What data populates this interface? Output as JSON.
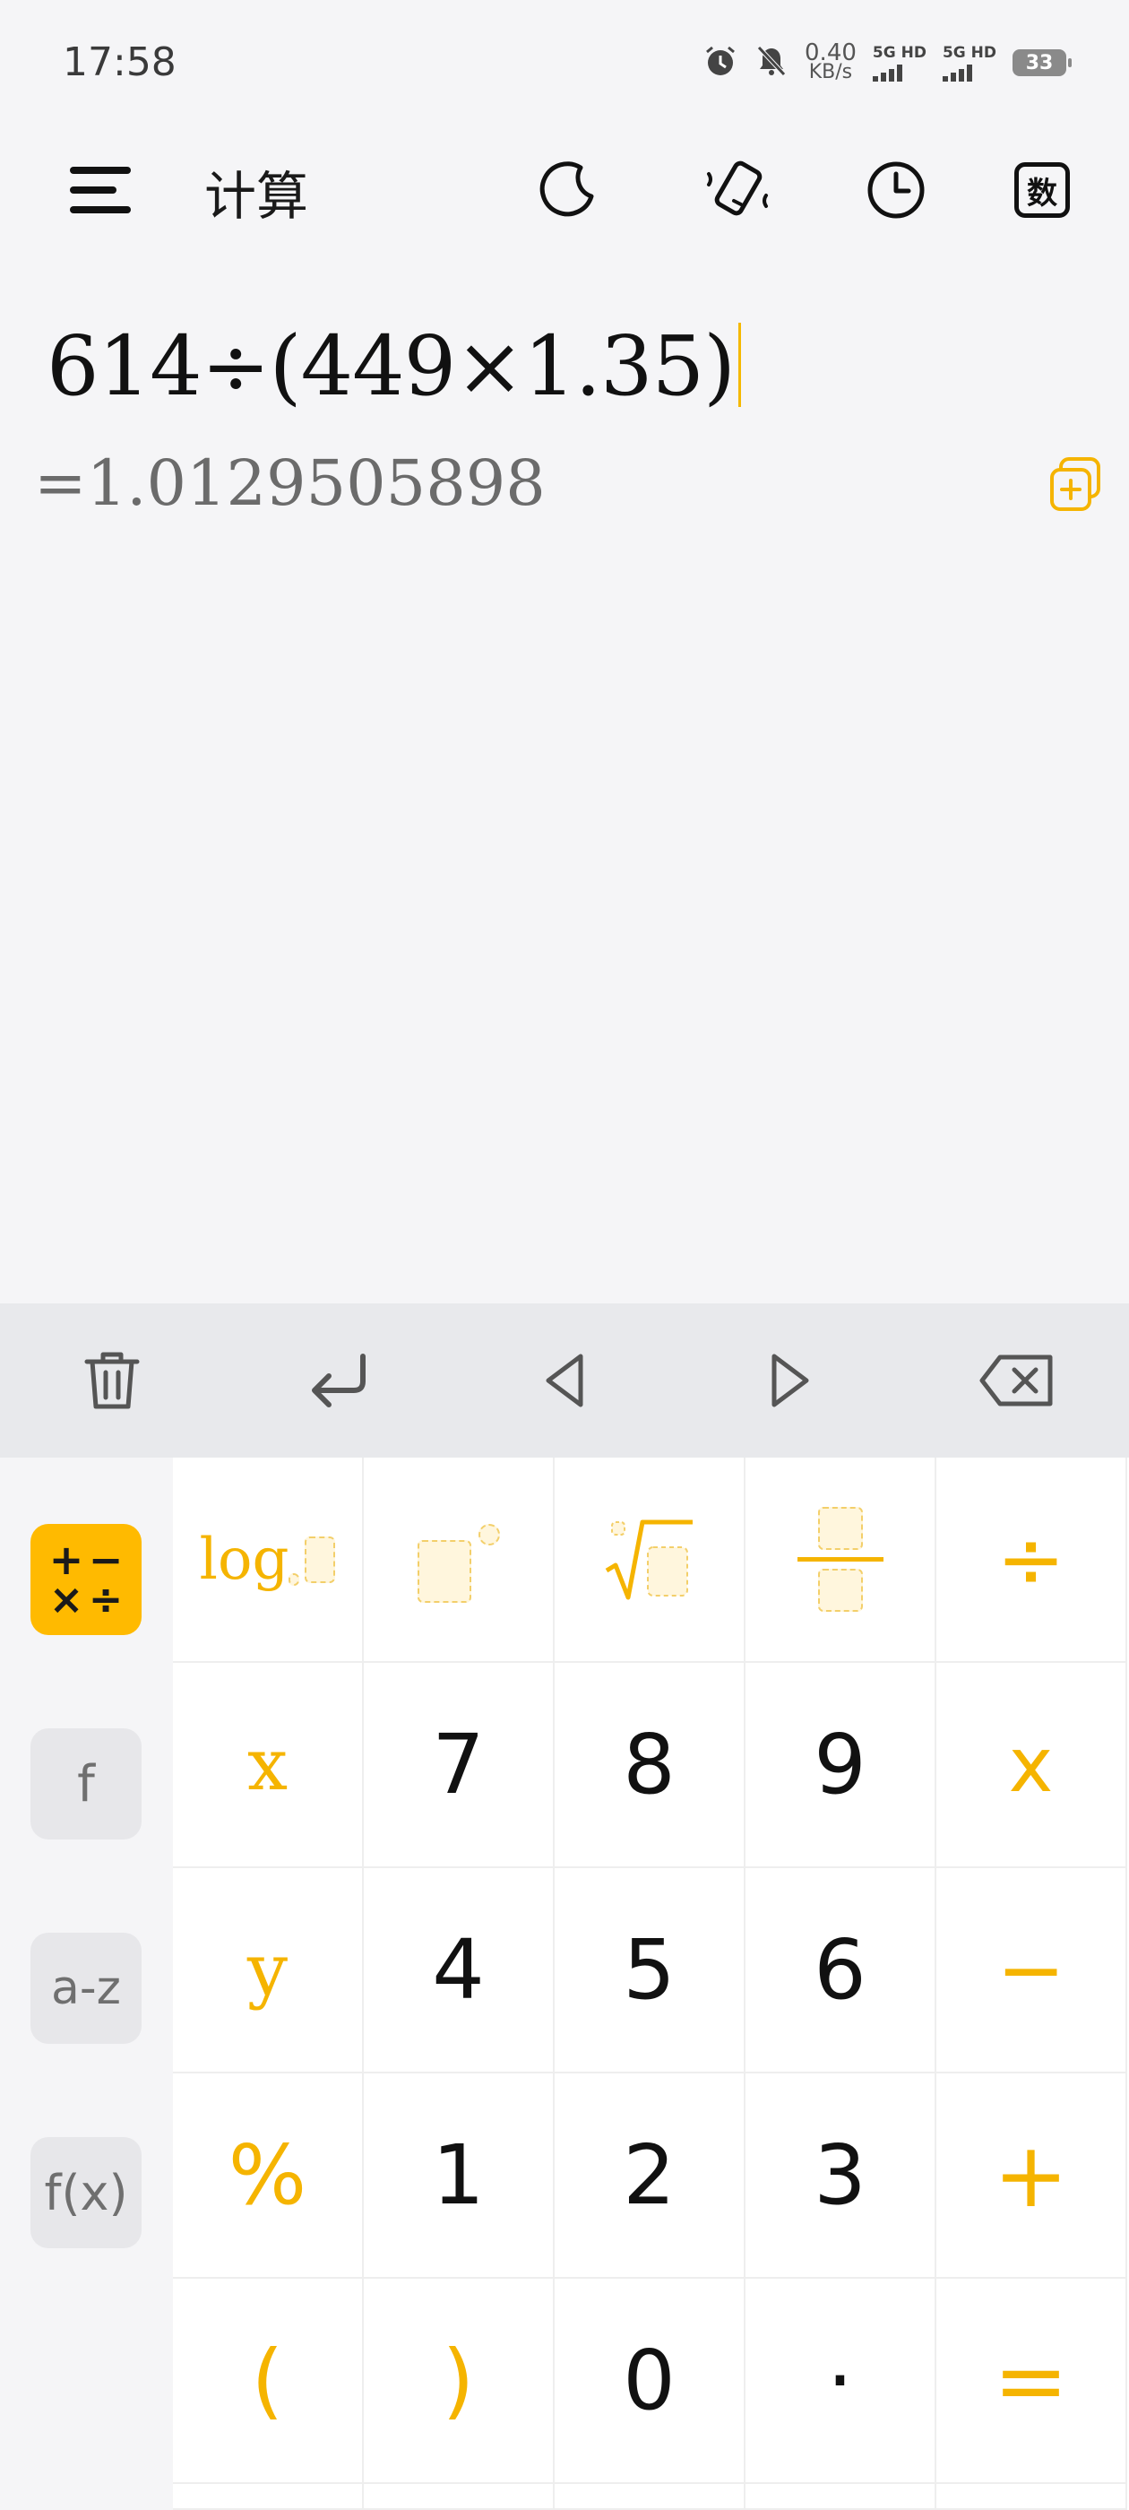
{
  "status": {
    "time": "17:58",
    "speed_value": "0.40",
    "speed_unit": "KB/s",
    "sim1_label": "5G HD",
    "sim2_label": "5G HD",
    "battery": "33"
  },
  "appbar": {
    "title": "计算",
    "mode_badge": "数"
  },
  "display": {
    "expression": "614÷(449×1.35)",
    "result": "=1.0129505898"
  },
  "keypad": {
    "side": [
      "f",
      "a-z",
      "f(x)"
    ],
    "side_active_ops": [
      "+",
      "−",
      "×",
      "÷"
    ],
    "log_label": "log",
    "rows": [
      [
        "x",
        "7",
        "8",
        "9",
        "x"
      ],
      [
        "y",
        "4",
        "5",
        "6",
        "−"
      ],
      [
        "%",
        "1",
        "2",
        "3",
        "+"
      ],
      [
        "(",
        ")",
        "0",
        "·",
        "="
      ]
    ],
    "divide": "÷"
  },
  "colors": {
    "accent": "#FFBA00",
    "accent_text": "#F5B400",
    "toolbar_bg": "#E8E9EC",
    "keypad_bg": "#FFFFFF"
  }
}
